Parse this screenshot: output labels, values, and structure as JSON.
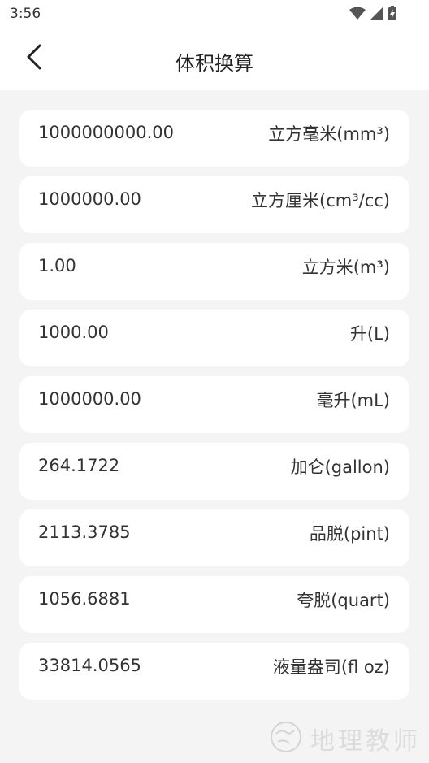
{
  "status": {
    "time": "3:56"
  },
  "header": {
    "title": "体积换算"
  },
  "rows": [
    {
      "value": "1000000000.00",
      "unit": "立方毫米(mm³)"
    },
    {
      "value": "1000000.00",
      "unit": "立方厘米(cm³/cc)"
    },
    {
      "value": "1.00",
      "unit": "立方米(m³)"
    },
    {
      "value": "1000.00",
      "unit": "升(L)"
    },
    {
      "value": "1000000.00",
      "unit": "毫升(mL)"
    },
    {
      "value": "264.1722",
      "unit": "加仑(gallon)"
    },
    {
      "value": "2113.3785",
      "unit": "品脱(pint)"
    },
    {
      "value": "1056.6881",
      "unit": "夸脱(quart)"
    },
    {
      "value": "33814.0565",
      "unit": "液量盎司(fl oz)"
    }
  ],
  "watermark": {
    "text": "地理教师"
  },
  "icons": {
    "back": "chevron-left-icon",
    "wifi": "wifi-icon",
    "signal": "signal-icon",
    "battery": "battery-charging-icon"
  },
  "colors": {
    "background": "#f4f4f4",
    "card": "#ffffff",
    "text": "#333333"
  }
}
